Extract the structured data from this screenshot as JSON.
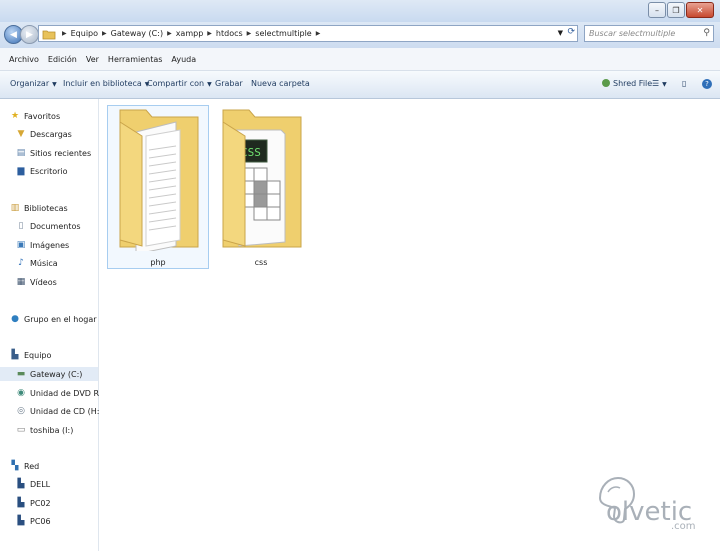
{
  "address": {
    "crumbs": [
      "Equipo",
      "Gateway (C:)",
      "xampp",
      "htdocs",
      "selectmultiple"
    ]
  },
  "search": {
    "placeholder": "Buscar selectmultiple"
  },
  "menu": [
    "Archivo",
    "Edición",
    "Ver",
    "Herramientas",
    "Ayuda"
  ],
  "toolbar": {
    "organize": "Organizar",
    "include": "Incluir en biblioteca",
    "share": "Compartir con",
    "burn": "Grabar",
    "new_folder": "Nueva carpeta",
    "shred": "Shred File"
  },
  "nav": {
    "favorites": "Favoritos",
    "fav_items": [
      "Descargas",
      "Sitios recientes",
      "Escritorio"
    ],
    "libraries": "Bibliotecas",
    "lib_items": [
      "Documentos",
      "Imágenes",
      "Música",
      "Vídeos"
    ],
    "homegroup": "Grupo en el hogar",
    "computer": "Equipo",
    "comp_items": [
      "Gateway (C:)",
      "Unidad de DVD RW (D:)",
      "Unidad de CD (H:)",
      "toshiba (I:)"
    ],
    "network": "Red",
    "net_items": [
      "DELL",
      "PC02",
      "PC06"
    ]
  },
  "folders": [
    {
      "name": "php",
      "selected": true
    },
    {
      "name": "css",
      "selected": false
    }
  ],
  "watermark": {
    "text": "olvetic",
    "suffix": ".com",
    "color": "#a9b0b8"
  },
  "colors": {
    "folder": "#f3d77e",
    "selection": "#a7cdf0"
  }
}
